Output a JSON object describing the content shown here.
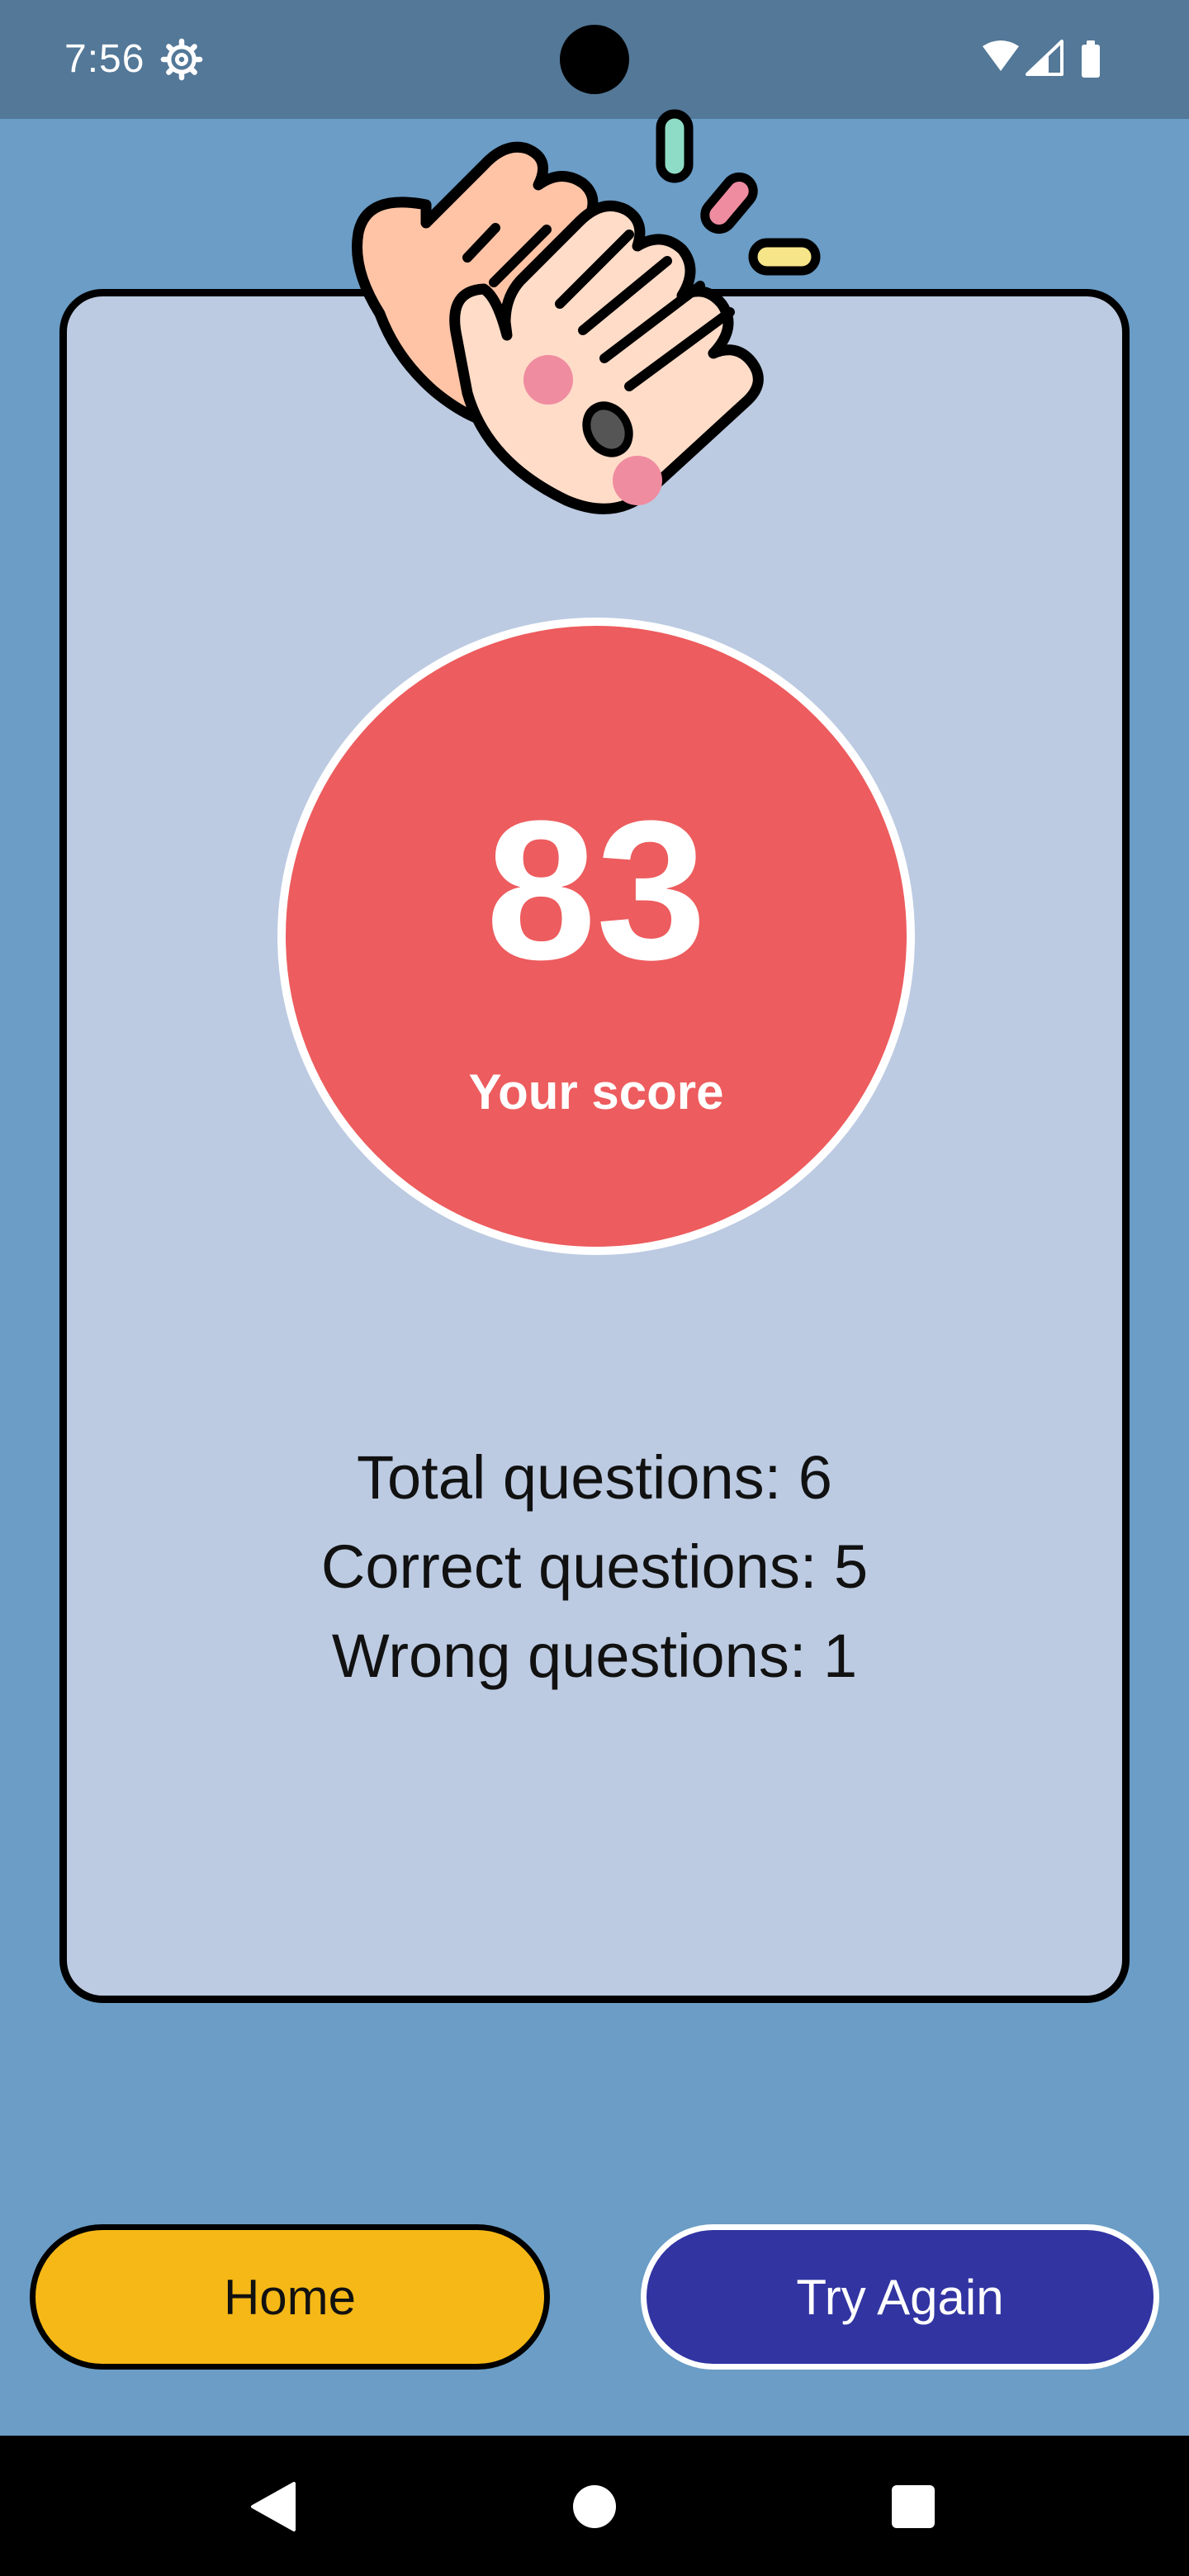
{
  "status_bar": {
    "time": "7:56",
    "icons": [
      "settings-gear-icon",
      "wifi-icon",
      "cellular-signal-icon",
      "battery-icon"
    ]
  },
  "result": {
    "illustration": "clapping-hands-icon",
    "score": "83",
    "score_label": "Your score",
    "stats": [
      "Total questions: 6",
      "Correct questions: 5",
      "Wrong questions: 1"
    ]
  },
  "actions": {
    "home_label": "Home",
    "try_again_label": "Try Again"
  },
  "nav_bar": {
    "icons": [
      "back-icon",
      "home-icon",
      "recents-icon"
    ]
  },
  "colors": {
    "background": "#6b9dc6",
    "status_bar": "#537898",
    "card": "#bccbe2",
    "score_circle": "#ed5c5e",
    "home_button": "#f5b816",
    "try_again_button": "#3134a1"
  }
}
